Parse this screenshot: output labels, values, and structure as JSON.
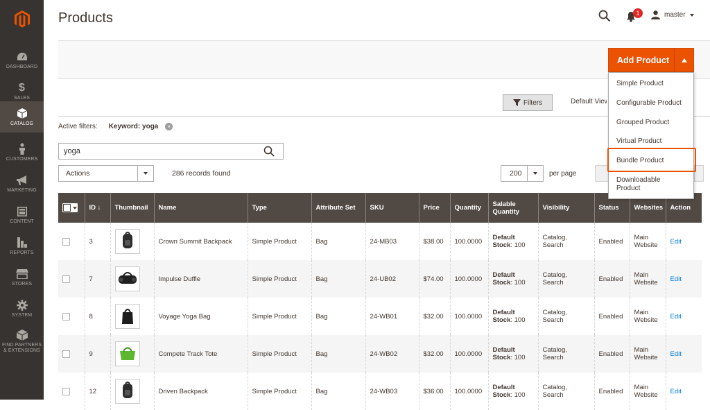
{
  "page": {
    "title": "Products"
  },
  "header": {
    "notification_count": "1",
    "user": "master"
  },
  "sidebar": {
    "items": [
      {
        "label": "DASHBOARD",
        "icon": "dashboard-icon"
      },
      {
        "label": "SALES",
        "icon": "dollar-icon"
      },
      {
        "label": "CATALOG",
        "icon": "cube-icon",
        "active": true
      },
      {
        "label": "CUSTOMERS",
        "icon": "person-icon"
      },
      {
        "label": "MARKETING",
        "icon": "megaphone-icon"
      },
      {
        "label": "CONTENT",
        "icon": "layout-icon"
      },
      {
        "label": "REPORTS",
        "icon": "bar-chart-icon"
      },
      {
        "label": "STORES",
        "icon": "store-icon"
      },
      {
        "label": "SYSTEM",
        "icon": "gear-icon"
      },
      {
        "label_line1": "FIND PARTNERS",
        "label_line2": "& EXTENSIONS",
        "icon": "box-icon"
      }
    ]
  },
  "toolbar": {
    "add_product": "Add Product",
    "menu": [
      "Simple Product",
      "Configurable Product",
      "Grouped Product",
      "Virtual Product",
      "Bundle Product",
      "Downloadable Product"
    ],
    "highlighted": "Bundle Product"
  },
  "filters": {
    "button": "Filters",
    "view": "Default View",
    "active_label": "Active filters:",
    "active_keyword": "Keyword: yoga"
  },
  "search": {
    "value": "yoga"
  },
  "grid": {
    "actions": "Actions",
    "records": "286 records found",
    "per_page_value": "200",
    "per_page_label": "per page",
    "columns": [
      "ID",
      "Thumbnail",
      "Name",
      "Type",
      "Attribute Set",
      "SKU",
      "Price",
      "Quantity",
      "Salable Quantity",
      "Visibility",
      "Status",
      "Websites",
      "Action"
    ],
    "rows": [
      {
        "id": "3",
        "name": "Crown Summit Backpack",
        "type": "Simple Product",
        "set": "Bag",
        "sku": "24-MB03",
        "price": "$38.00",
        "qty": "100.0000",
        "salable_source": "Default",
        "salable_label": "Stock",
        "salable_value": ": 100",
        "visibility": "Catalog, Search",
        "status": "Enabled",
        "websites": "Main Website",
        "action": "Edit",
        "thumb": "backpack-icon"
      },
      {
        "id": "7",
        "name": "Impulse Duffle",
        "type": "Simple Product",
        "set": "Bag",
        "sku": "24-UB02",
        "price": "$74.00",
        "qty": "100.0000",
        "salable_source": "Default",
        "salable_label": "Stock",
        "salable_value": ": 100",
        "visibility": "Catalog, Search",
        "status": "Enabled",
        "websites": "Main Website",
        "action": "Edit",
        "thumb": "duffle-icon"
      },
      {
        "id": "8",
        "name": "Voyage Yoga Bag",
        "type": "Simple Product",
        "set": "Bag",
        "sku": "24-WB01",
        "price": "$32.00",
        "qty": "100.0000",
        "salable_source": "Default",
        "salable_label": "Stock",
        "salable_value": ": 100",
        "visibility": "Catalog, Search",
        "status": "Enabled",
        "websites": "Main Website",
        "action": "Edit",
        "thumb": "tote-icon"
      },
      {
        "id": "9",
        "name": "Compete Track Tote",
        "type": "Simple Product",
        "set": "Bag",
        "sku": "24-WB02",
        "price": "$32.00",
        "qty": "100.0000",
        "salable_source": "Default",
        "salable_label": "Stock",
        "salable_value": ": 100",
        "visibility": "Catalog, Search",
        "status": "Enabled",
        "websites": "Main Website",
        "action": "Edit",
        "thumb": "green-tote-icon"
      },
      {
        "id": "12",
        "name": "Driven Backpack",
        "type": "Simple Product",
        "set": "Bag",
        "sku": "24-WB03",
        "price": "$36.00",
        "qty": "100.0000",
        "salable_source": "Default",
        "salable_label": "Stock",
        "salable_value": ": 100",
        "visibility": "Catalog, Search",
        "status": "Enabled",
        "websites": "Main Website",
        "action": "Edit",
        "thumb": "backpack-icon"
      }
    ]
  },
  "colors": {
    "sidebar": "#373330",
    "accent": "#eb5202",
    "grid_header": "#514943",
    "link": "#007bdb"
  }
}
